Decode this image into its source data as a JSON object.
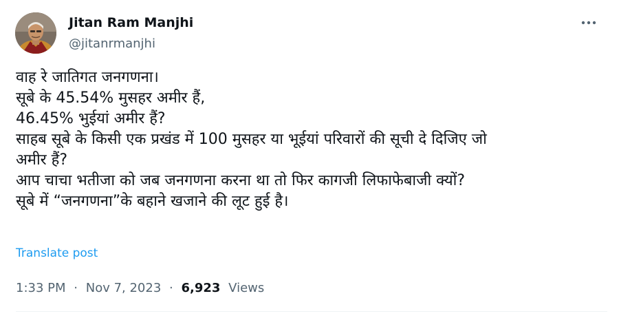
{
  "author": {
    "name": "Jitan Ram Manjhi",
    "handle": "@jitanrmanjhi"
  },
  "tweet": {
    "lines": [
      "वाह रे जातिगत जनगणना।",
      "सूबे के 45.54% मुसहर अमीर हैं,",
      "46.45% भुईयां अमीर हैं?",
      "साहब सूबे के किसी एक प्रखंड में 100 मुसहर या भूईयां परिवारों की सूची दे दिजिए जो",
      "अमीर हैं?",
      "आप चाचा भतीजा को जब जनगणना करना था तो फिर कागजी लिफाफेबाजी क्यों?",
      "सूबे में “जनगणना”के बहाने खजाने की लूट हुई है।"
    ]
  },
  "translate_label": "Translate post",
  "meta": {
    "time": "1:33 PM",
    "separator": "·",
    "date": "Nov 7, 2023",
    "views_count": "6,923",
    "views_label": "Views"
  },
  "icons": {
    "more": "more-horizontal-icon",
    "avatar": "avatar-photo"
  },
  "colors": {
    "text": "#0f1419",
    "secondary": "#536471",
    "link": "#1d9bf0"
  }
}
